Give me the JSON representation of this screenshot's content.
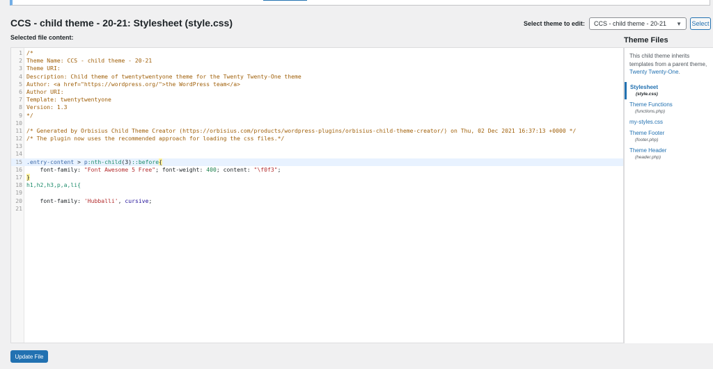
{
  "page": {
    "title": "CCS - child theme - 20-21: Stylesheet (style.css)",
    "selected_file_label": "Selected file content:"
  },
  "theme_picker": {
    "label": "Select theme to edit:",
    "selected": "CCS - child theme - 20-21",
    "button": "Select"
  },
  "editor": {
    "active_line": 15,
    "lines": [
      {
        "n": "1",
        "t": "/*",
        "k": "comment"
      },
      {
        "n": "2",
        "t": "Theme Name: CCS - child theme - 20-21",
        "k": "comment"
      },
      {
        "n": "3",
        "t": "Theme URI:",
        "k": "comment"
      },
      {
        "n": "4",
        "t": "Description: Child theme of twentytwentyone theme for the Twenty Twenty-One theme",
        "k": "comment"
      },
      {
        "n": "5",
        "t": "Author: <a href=\"https://wordpress.org/\">the WordPress team</a>",
        "k": "comment"
      },
      {
        "n": "6",
        "t": "Author URI:",
        "k": "comment"
      },
      {
        "n": "7",
        "t": "Template: twentytwentyone",
        "k": "comment"
      },
      {
        "n": "8",
        "t": "Version: 1.3",
        "k": "comment"
      },
      {
        "n": "9",
        "t": "*/",
        "k": "comment"
      },
      {
        "n": "10",
        "t": "",
        "k": "plain"
      },
      {
        "n": "11",
        "t": "/* Generated by Orbisius Child Theme Creator (https://orbisius.com/products/wordpress-plugins/orbisius-child-theme-creator/) on Thu, 02 Dec 2021 16:37:13 +0000 */",
        "k": "comment"
      },
      {
        "n": "12",
        "t": "/* The plugin now uses the recommended approach for loading the css files.*/",
        "k": "comment"
      },
      {
        "n": "13",
        "t": "",
        "k": "plain"
      },
      {
        "n": "14",
        "t": "",
        "k": "plain"
      },
      {
        "n": "15",
        "k": "rule1",
        "sel1": ".entry-content",
        "sel2": " > ",
        "sel3": "p",
        "sel4": ":nth-child",
        "sel5": "(3)",
        "sel6": "::before",
        "sel7": "{"
      },
      {
        "n": "16",
        "k": "decl1",
        "p1": "    font-family: ",
        "s1": "\"Font Awesome 5 Free\"",
        "p2": "; font-weight: ",
        "v1": "400",
        "p3": "; content: ",
        "s2": "\"\\f0f3\"",
        "p4": ";"
      },
      {
        "n": "17",
        "t": "}",
        "k": "brace"
      },
      {
        "n": "18",
        "t": "h1,h2,h3,p,a,li{",
        "k": "selector2"
      },
      {
        "n": "19",
        "t": "",
        "k": "plain"
      },
      {
        "n": "20",
        "k": "decl2",
        "p1": "    font-family: ",
        "s1": "'Hubballi'",
        "p2": ", ",
        "v1": "cursive",
        "p3": ";"
      },
      {
        "n": "21",
        "t": "",
        "k": "plain"
      }
    ]
  },
  "sidebar": {
    "title": "Theme Files",
    "desc_prefix": "This child theme inherits templates from a parent theme, ",
    "parent_link": "Twenty Twenty-One",
    "desc_suffix": ".",
    "files": [
      {
        "name": "Stylesheet",
        "file": "(style.css)",
        "current": true
      },
      {
        "name": "Theme Functions",
        "file": "(functions.php)",
        "current": false
      },
      {
        "name": "my-styles.css",
        "file": "",
        "current": false
      },
      {
        "name": "Theme Footer",
        "file": "(footer.php)",
        "current": false
      },
      {
        "name": "Theme Header",
        "file": "(header.php)",
        "current": false
      }
    ]
  },
  "actions": {
    "update_button": "Update File"
  },
  "colors": {
    "accent": "#2271b1",
    "background": "#f0f0f1"
  }
}
